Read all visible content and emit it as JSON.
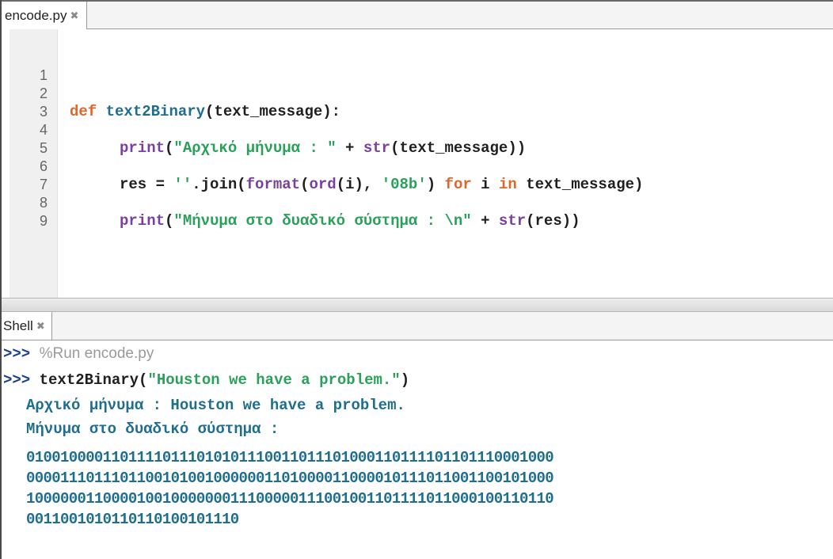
{
  "editor": {
    "tab_label": "encode.py",
    "tab_close": "✖",
    "line_numbers": [
      "1",
      "2",
      "3",
      "4",
      "5",
      "6",
      "7",
      "8",
      "9"
    ],
    "line2": {
      "kw": "def",
      "fn": "text2Binary",
      "rest": "(text_message):"
    },
    "line4": {
      "bi": "print",
      "p1": "(",
      "st": "\"Αρχικό μήνυμα : \"",
      "p2": " + ",
      "bi2": "str",
      "rest": "(text_message))"
    },
    "line6": {
      "p1": "res = ",
      "st1": "''",
      "p2": ".join(",
      "bi1": "format",
      "p3": "(",
      "bi2": "ord",
      "p4": "(i), ",
      "st2": "'08b'",
      "p5": ") ",
      "kw1": "for",
      "p6": " i ",
      "kw2": "in",
      "p7": " text_message)"
    },
    "line8": {
      "bi": "print",
      "p1": "(",
      "st": "\"Μήνυμα στο δυαδικό σύστημα : \\n\"",
      "p2": " + ",
      "bi2": "str",
      "rest": "(res))"
    }
  },
  "shell": {
    "tab_label": "Shell",
    "tab_close": "✖",
    "prompt": ">>>",
    "run_command": "%Run encode.py",
    "call_fn": "text2Binary(",
    "call_arg": "\"Houston we have a problem.\"",
    "call_close": ")",
    "output": [
      "Αρχικό μήνυμα : Houston we have a problem.",
      "Μήνυμα στο δυαδικό σύστημα :",
      "01001000011011110111010101110011011101000110111101101110001000",
      "00001110111011001010010000001101000011000010111011001100101000",
      "10000001100001001000000011100000111001001101111011000100110110",
      "0011001010110110100101110"
    ]
  }
}
